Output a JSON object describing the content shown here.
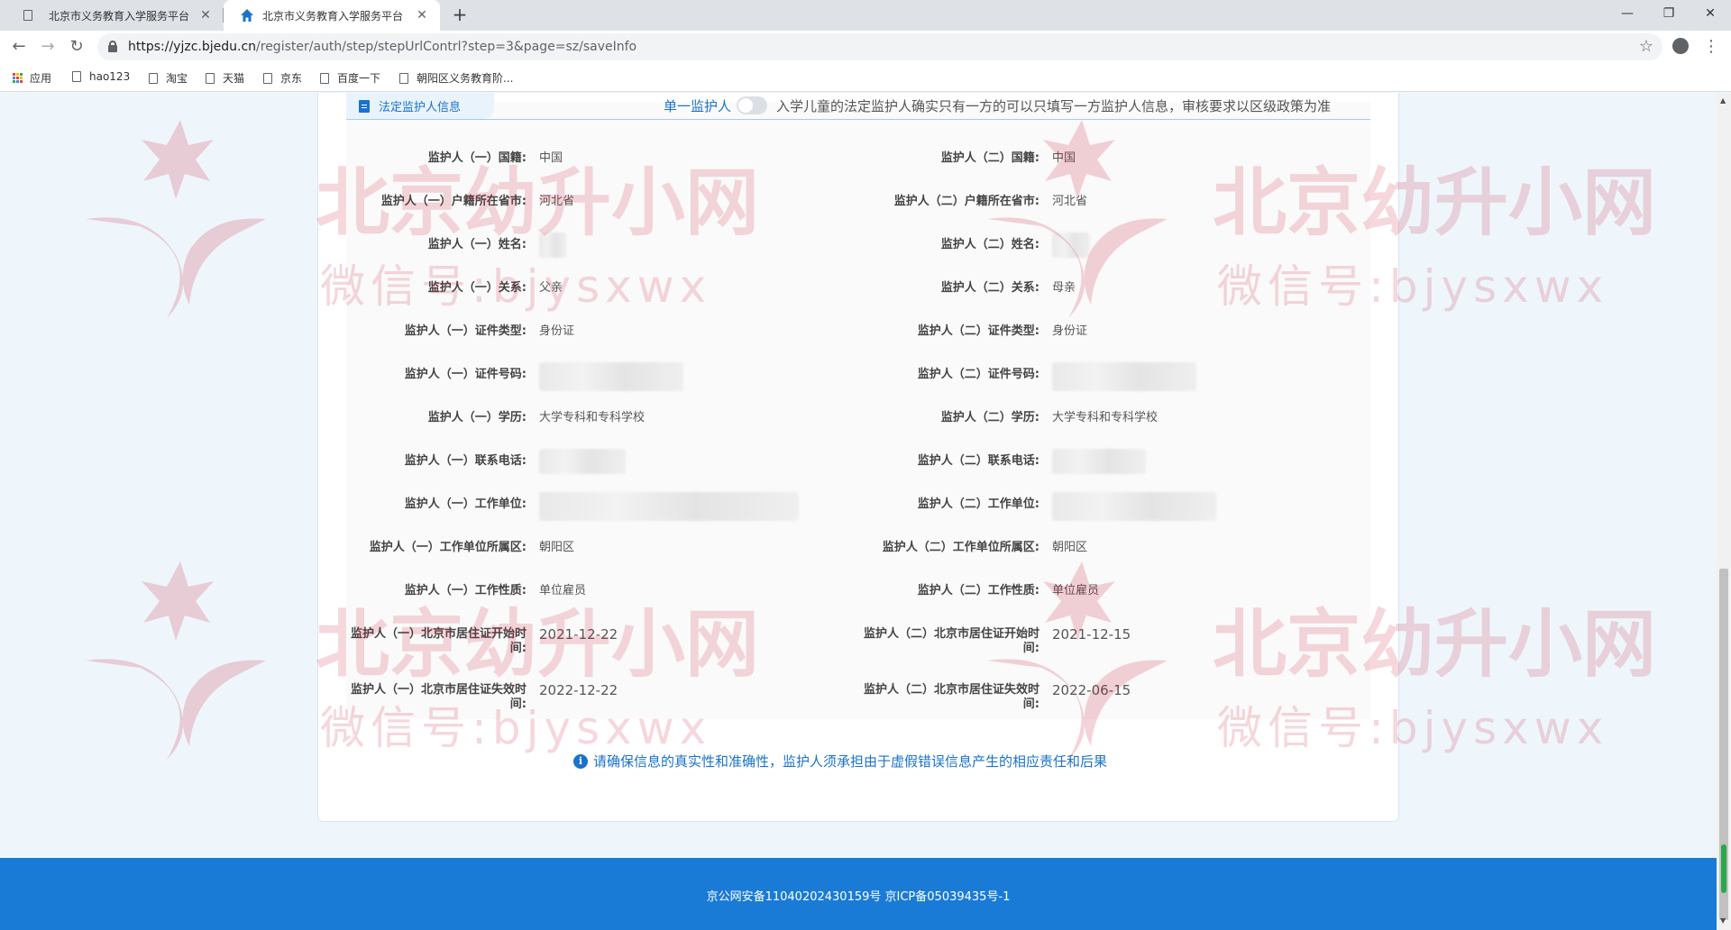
{
  "browser": {
    "tabs": [
      {
        "title": "北京市义务教育入学服务平台",
        "active": false
      },
      {
        "title": "北京市义务教育入学服务平台",
        "active": true
      }
    ],
    "url_host": "https://yjzc.bjedu.cn",
    "url_path": "/register/auth/step/stepUrlContrl?step=3&page=sz/saveInfo",
    "bookmarks": [
      "应用",
      "hao123",
      "淘宝",
      "天猫",
      "京东",
      "百度一下",
      "朝阳区义务教育阶..."
    ]
  },
  "section": {
    "tab_label": "法定监护人信息",
    "single_guardian_label": "单一监护人",
    "single_guardian_toggle": "off",
    "single_guardian_note": "入学儿童的法定监护人确实只有一方的可以只填写一方监护人信息，审核要求以区级政策为准"
  },
  "guardian1": [
    {
      "label": "监护人（一）国籍:",
      "value": "中国"
    },
    {
      "label": "监护人（一）户籍所在省市:",
      "value": "河北省"
    },
    {
      "label": "监护人（一）姓名:",
      "value": ""
    },
    {
      "label": "监护人（一）关系:",
      "value": "父亲"
    },
    {
      "label": "监护人（一）证件类型:",
      "value": "身份证"
    },
    {
      "label": "监护人（一）证件号码:",
      "value": ""
    },
    {
      "label": "监护人（一）学历:",
      "value": "大学专科和专科学校"
    },
    {
      "label": "监护人（一）联系电话:",
      "value": ""
    },
    {
      "label": "监护人（一）工作单位:",
      "value": ""
    },
    {
      "label": "监护人（一）工作单位所属区:",
      "value": "朝阳区"
    },
    {
      "label": "监护人（一）工作性质:",
      "value": "单位雇员"
    },
    {
      "label": "监护人（一）北京市居住证开始时间:",
      "value": "2021-12-22"
    },
    {
      "label": "监护人（一）北京市居住证失效时间:",
      "value": "2022-12-22"
    }
  ],
  "guardian2": [
    {
      "label": "监护人（二）国籍:",
      "value": "中国"
    },
    {
      "label": "监护人（二）户籍所在省市:",
      "value": "河北省"
    },
    {
      "label": "监护人（二）姓名:",
      "value": ""
    },
    {
      "label": "监护人（二）关系:",
      "value": "母亲"
    },
    {
      "label": "监护人（二）证件类型:",
      "value": "身份证"
    },
    {
      "label": "监护人（二）证件号码:",
      "value": ""
    },
    {
      "label": "监护人（二）学历:",
      "value": "大学专科和专科学校"
    },
    {
      "label": "监护人（二）联系电话:",
      "value": ""
    },
    {
      "label": "监护人（二）工作单位:",
      "value": ""
    },
    {
      "label": "监护人（二）工作单位所属区:",
      "value": "朝阳区"
    },
    {
      "label": "监护人（二）工作性质:",
      "value": "单位雇员"
    },
    {
      "label": "监护人（二）北京市居住证开始时间:",
      "value": "2021-12-15"
    },
    {
      "label": "监护人（二）北京市居住证失效时间:",
      "value": "2022-06-15"
    }
  ],
  "notice": "请确保信息的真实性和准确性，监护人须承担由于虚假错误信息产生的相应责任和后果",
  "footer": "京公网安备11040202430159号 京ICP备05039435号-1",
  "watermark": {
    "title": "北京幼升小网",
    "subtitle": "微信号:bjysxwx"
  },
  "colors": {
    "accent": "#1a73c8",
    "footer": "#1a7bd6",
    "page_bg": "#eef6fb"
  }
}
